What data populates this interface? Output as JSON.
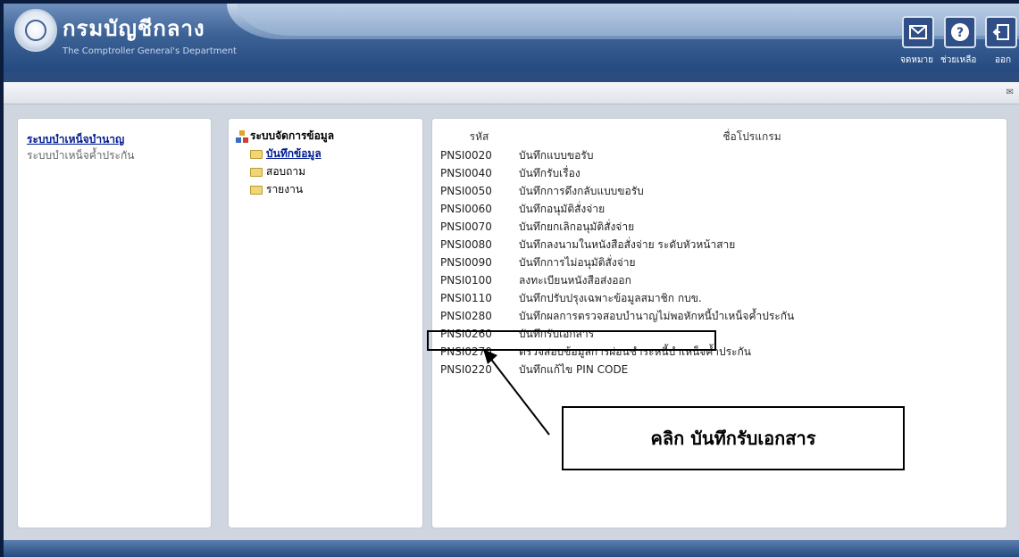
{
  "header": {
    "title_th": "กรมบัญชีกลาง",
    "title_en": "The Comptroller General's Department",
    "buttons": [
      {
        "label": "จดหมาย",
        "icon": "mail-icon"
      },
      {
        "label": "ช่วยเหลือ",
        "icon": "help-icon"
      },
      {
        "label": "ออก",
        "icon": "exit-icon"
      }
    ]
  },
  "left_nav": {
    "items": [
      {
        "label": "ระบบบำเหน็จบำนาญ",
        "active": true
      },
      {
        "label": "ระบบบำเหน็จค้ำประกัน",
        "active": false
      }
    ]
  },
  "tree": {
    "root": "ระบบจัดการข้อมูล",
    "items": [
      {
        "label": "บันทึกข้อมูล",
        "active": true
      },
      {
        "label": "สอบถาม",
        "active": false
      },
      {
        "label": "รายงาน",
        "active": false
      }
    ]
  },
  "table": {
    "headers": {
      "code": "รหัส",
      "name": "ชื่อโปรแกรม"
    },
    "rows": [
      {
        "code": "PNSI0020",
        "name": "บันทึกแบบขอรับ"
      },
      {
        "code": "PNSI0040",
        "name": "บันทึกรับเรื่อง"
      },
      {
        "code": "PNSI0050",
        "name": "บันทึกการดึงกลับแบบขอรับ"
      },
      {
        "code": "PNSI0060",
        "name": "บันทึกอนุมัติสั่งจ่าย"
      },
      {
        "code": "PNSI0070",
        "name": "บันทึกยกเลิกอนุมัติสั่งจ่าย"
      },
      {
        "code": "PNSI0080",
        "name": "บันทึกลงนามในหนังสือสั่งจ่าย ระดับหัวหน้าสาย"
      },
      {
        "code": "PNSI0090",
        "name": "บันทึกการไม่อนุมัติสั่งจ่าย"
      },
      {
        "code": "PNSI0100",
        "name": "ลงทะเบียนหนังสือส่งออก"
      },
      {
        "code": "PNSI0110",
        "name": "บันทึกปรับปรุงเฉพาะข้อมูลสมาชิก กบข."
      },
      {
        "code": "PNSI0280",
        "name": "บันทึกผลการตรวจสอบบำนาญไม่พอหักหนี้บำเหน็จค้ำประกัน"
      },
      {
        "code": "PNSI0260",
        "name": "บันทึกรับเอกสาร"
      },
      {
        "code": "PNSI0270",
        "name": "ตรวจสอบข้อมูลการผ่อนชำระหนี้บำเหน็จค้ำประกัน"
      },
      {
        "code": "PNSI0220",
        "name": "บันทึกแก้ไข PIN CODE"
      }
    ]
  },
  "callout": {
    "text": "คลิก บันทึกรับเอกสาร"
  },
  "colors": {
    "header": "#244a80",
    "active_link": "#001b8f",
    "panel_bg": "#cfd6e0"
  }
}
